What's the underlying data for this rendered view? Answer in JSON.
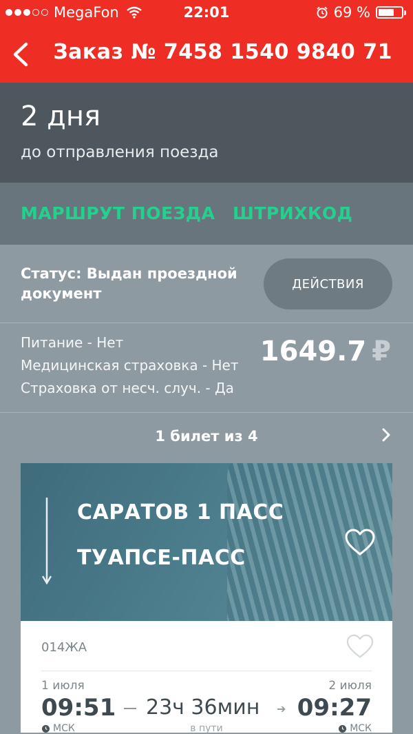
{
  "status_bar": {
    "carrier": "MegaFon",
    "time": "22:01",
    "battery": "69 %",
    "battery_level": 0.69
  },
  "header": {
    "title": "Заказ № 7458 1540 9840 71"
  },
  "countdown": {
    "value": "2 дня",
    "label": "до отправления поезда"
  },
  "tabs": [
    {
      "label": "МАРШРУТ ПОЕЗДА"
    },
    {
      "label": "ШТРИХКОД"
    }
  ],
  "order_status": {
    "text": "Статус: Выдан проездной документ",
    "actions_label": "ДЕЙСТВИЯ"
  },
  "extras": {
    "lines": [
      "Питание - Нет",
      "Медицинская страховка - Нет",
      "Страховка от несч. случ. - Да"
    ],
    "price": "1649.7",
    "currency": "₽"
  },
  "ticket_nav": {
    "counter": "1 билет из 4"
  },
  "route": {
    "from": "САРАТОВ 1 ПАСС",
    "to": "ТУАПСЕ-ПАСС"
  },
  "train": {
    "number": "014ЖА",
    "departure_date": "1 июля",
    "arrival_date": "2 июля",
    "departure_time": "09:51",
    "arrival_time": "09:27",
    "duration": "23ч 36мин",
    "in_transit_label": "в пути",
    "tz_left": "МСК",
    "tz_right": "МСК"
  },
  "colors": {
    "accent_red": "#ee2e24",
    "tab_green": "#23d08e",
    "dark_band": "#4d575d"
  }
}
